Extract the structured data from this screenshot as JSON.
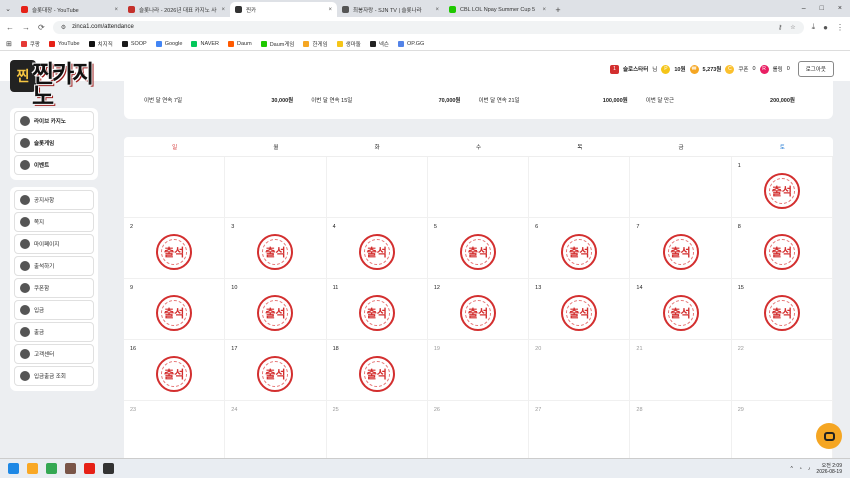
{
  "browser": {
    "tabs": [
      {
        "label": "슬롯대장 - YouTube",
        "color": "#e62117",
        "close": "×"
      },
      {
        "label": "슬롯나라 - 2026년 대표 카지노 사이트",
        "color": "#c4302b",
        "close": "×"
      },
      {
        "label": "찐카",
        "color": "#333333",
        "close": "×"
      },
      {
        "label": "최봉자랑 - SJN TV | 슬롯나라",
        "color": "#555555",
        "close": "×"
      },
      {
        "label": "CBL LOL Npay Summer Cup 5",
        "color": "#1ec800",
        "close": "×"
      }
    ],
    "tab_search": "⌄",
    "new_tab": "+",
    "window": {
      "minimize": "–",
      "maximize": "□",
      "close": "×"
    },
    "url": "zinca1.com/attendance",
    "bookmarks": [
      {
        "label": "쿠팡",
        "color": "#e53935"
      },
      {
        "label": "YouTube",
        "color": "#e62117"
      },
      {
        "label": "치지직",
        "color": "#111111"
      },
      {
        "label": "SOOP",
        "color": "#1a1a1a"
      },
      {
        "label": "Google",
        "color": "#4285f4"
      },
      {
        "label": "NAVER",
        "color": "#03c75a"
      },
      {
        "label": "Daum",
        "color": "#ff5a00"
      },
      {
        "label": "Daum게임",
        "color": "#1ec800"
      },
      {
        "label": "한게임",
        "color": "#f5a623"
      },
      {
        "label": "생마돌",
        "color": "#f5c518"
      },
      {
        "label": "넥슨",
        "color": "#222222"
      },
      {
        "label": "OP.GG",
        "color": "#5383e8"
      }
    ]
  },
  "site": {
    "logo_badge": "찐",
    "logo_text": "찐카지노",
    "user": {
      "level": "1",
      "name": "슬로스타터",
      "suffix": "님",
      "points": "10원",
      "money": "5,273원",
      "coupon_label": "쿠폰",
      "coupon_count": "0",
      "rolling_label": "롤링",
      "rolling_count": "0",
      "logout": "로그아웃"
    },
    "sidebar_main": [
      {
        "label": "라이브 카지노",
        "icon": "chips-icon"
      },
      {
        "label": "슬롯게임",
        "icon": "slot-icon"
      },
      {
        "label": "이벤트",
        "icon": "gift-icon"
      }
    ],
    "sidebar_sub": [
      {
        "label": "공지사항",
        "icon": "megaphone-icon"
      },
      {
        "label": "쪽지",
        "icon": "message-icon"
      },
      {
        "label": "마이페이지",
        "icon": "user-icon"
      },
      {
        "label": "출석하기",
        "icon": "calendar-icon"
      },
      {
        "label": "쿠폰함",
        "icon": "coupon-icon"
      },
      {
        "label": "입금",
        "icon": "deposit-icon"
      },
      {
        "label": "출금",
        "icon": "withdraw-icon"
      },
      {
        "label": "고객센터",
        "icon": "support-icon"
      },
      {
        "label": "입금출금 조회",
        "icon": "history-icon"
      }
    ],
    "summary": [
      {
        "label": "이번 달 연속 7일",
        "value": "30,000원"
      },
      {
        "label": "이번 달 연속 15일",
        "value": "70,000원"
      },
      {
        "label": "이번 달 연속 21일",
        "value": "100,000원"
      },
      {
        "label": "이번 달 만근",
        "value": "200,000원"
      }
    ],
    "weekdays": [
      {
        "label": "일",
        "color": "#d32f2f"
      },
      {
        "label": "월",
        "color": "#222222"
      },
      {
        "label": "화",
        "color": "#222222"
      },
      {
        "label": "수",
        "color": "#222222"
      },
      {
        "label": "목",
        "color": "#222222"
      },
      {
        "label": "금",
        "color": "#222222"
      },
      {
        "label": "토",
        "color": "#1976d2"
      }
    ],
    "stamp_label": "출석",
    "days": [
      {
        "n": "",
        "stamp": false
      },
      {
        "n": "",
        "stamp": false
      },
      {
        "n": "",
        "stamp": false
      },
      {
        "n": "",
        "stamp": false
      },
      {
        "n": "",
        "stamp": false
      },
      {
        "n": "",
        "stamp": false
      },
      {
        "n": "1",
        "stamp": true
      },
      {
        "n": "2",
        "stamp": true
      },
      {
        "n": "3",
        "stamp": true
      },
      {
        "n": "4",
        "stamp": true
      },
      {
        "n": "5",
        "stamp": true
      },
      {
        "n": "6",
        "stamp": true
      },
      {
        "n": "7",
        "stamp": true
      },
      {
        "n": "8",
        "stamp": true
      },
      {
        "n": "9",
        "stamp": true
      },
      {
        "n": "10",
        "stamp": true
      },
      {
        "n": "11",
        "stamp": true
      },
      {
        "n": "12",
        "stamp": true
      },
      {
        "n": "13",
        "stamp": true
      },
      {
        "n": "14",
        "stamp": true
      },
      {
        "n": "15",
        "stamp": true
      },
      {
        "n": "16",
        "stamp": true
      },
      {
        "n": "17",
        "stamp": true
      },
      {
        "n": "18",
        "stamp": true
      },
      {
        "n": "19",
        "stamp": false
      },
      {
        "n": "20",
        "stamp": false
      },
      {
        "n": "21",
        "stamp": false
      },
      {
        "n": "22",
        "stamp": false
      },
      {
        "n": "23",
        "stamp": false
      },
      {
        "n": "24",
        "stamp": false
      },
      {
        "n": "25",
        "stamp": false
      },
      {
        "n": "26",
        "stamp": false
      },
      {
        "n": "27",
        "stamp": false
      },
      {
        "n": "28",
        "stamp": false
      },
      {
        "n": "29",
        "stamp": false
      }
    ]
  },
  "taskbar": {
    "apps": [
      {
        "name": "windows-start-icon",
        "color": "#1e88e5"
      },
      {
        "name": "explorer-icon",
        "color": "#f9a825"
      },
      {
        "name": "chrome-icon",
        "color": "#34a853"
      },
      {
        "name": "game-icon",
        "color": "#795548"
      },
      {
        "name": "youtube-icon",
        "color": "#e62117"
      },
      {
        "name": "app-icon",
        "color": "#333333"
      }
    ],
    "time": "오전 2:09",
    "date": "2026-08-19"
  }
}
